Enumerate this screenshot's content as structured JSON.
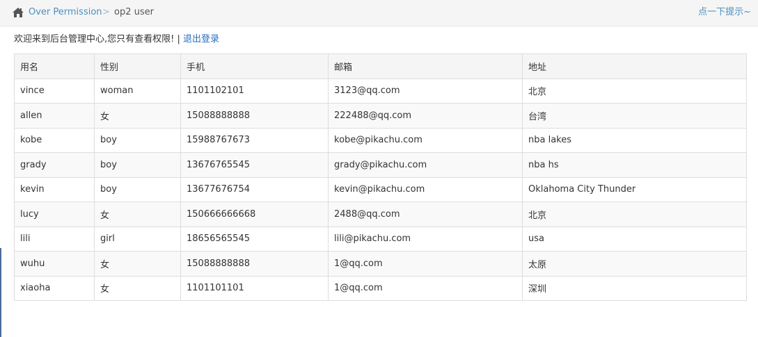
{
  "breadcrumb": {
    "home_icon": "home-icon",
    "parent": "Over Permission",
    "separator": ">",
    "current": "op2 user",
    "hint": "点一下提示~"
  },
  "welcome": {
    "text": "欢迎来到后台管理中心,您只有查看权限!",
    "separator": "|",
    "logout": "退出登录"
  },
  "table": {
    "headers": [
      "用名",
      "性别",
      "手机",
      "邮箱",
      "地址"
    ],
    "rows": [
      [
        "vince",
        "woman",
        "1101102101",
        "3123@qq.com",
        "北京"
      ],
      [
        "allen",
        "女",
        "15088888888",
        "222488@qq.com",
        "台湾"
      ],
      [
        "kobe",
        "boy",
        "15988767673",
        "kobe@pikachu.com",
        "nba lakes"
      ],
      [
        "grady",
        "boy",
        "13676765545",
        "grady@pikachu.com",
        "nba hs"
      ],
      [
        "kevin",
        "boy",
        "13677676754",
        "kevin@pikachu.com",
        "Oklahoma City Thunder"
      ],
      [
        "lucy",
        "女",
        "150666666668",
        "2488@qq.com",
        "北京"
      ],
      [
        "lili",
        "girl",
        "18656565545",
        "lili@pikachu.com",
        "usa"
      ],
      [
        "wuhu",
        "女",
        "15088888888",
        "1@qq.com",
        "太原"
      ],
      [
        "xiaoha",
        "女",
        "1101101101",
        "1@qq.com",
        "深圳"
      ]
    ]
  },
  "colors": {
    "link": "#4c8fbd",
    "breadcrumb_bg": "#f5f5f5",
    "table_border": "#dddddd"
  }
}
